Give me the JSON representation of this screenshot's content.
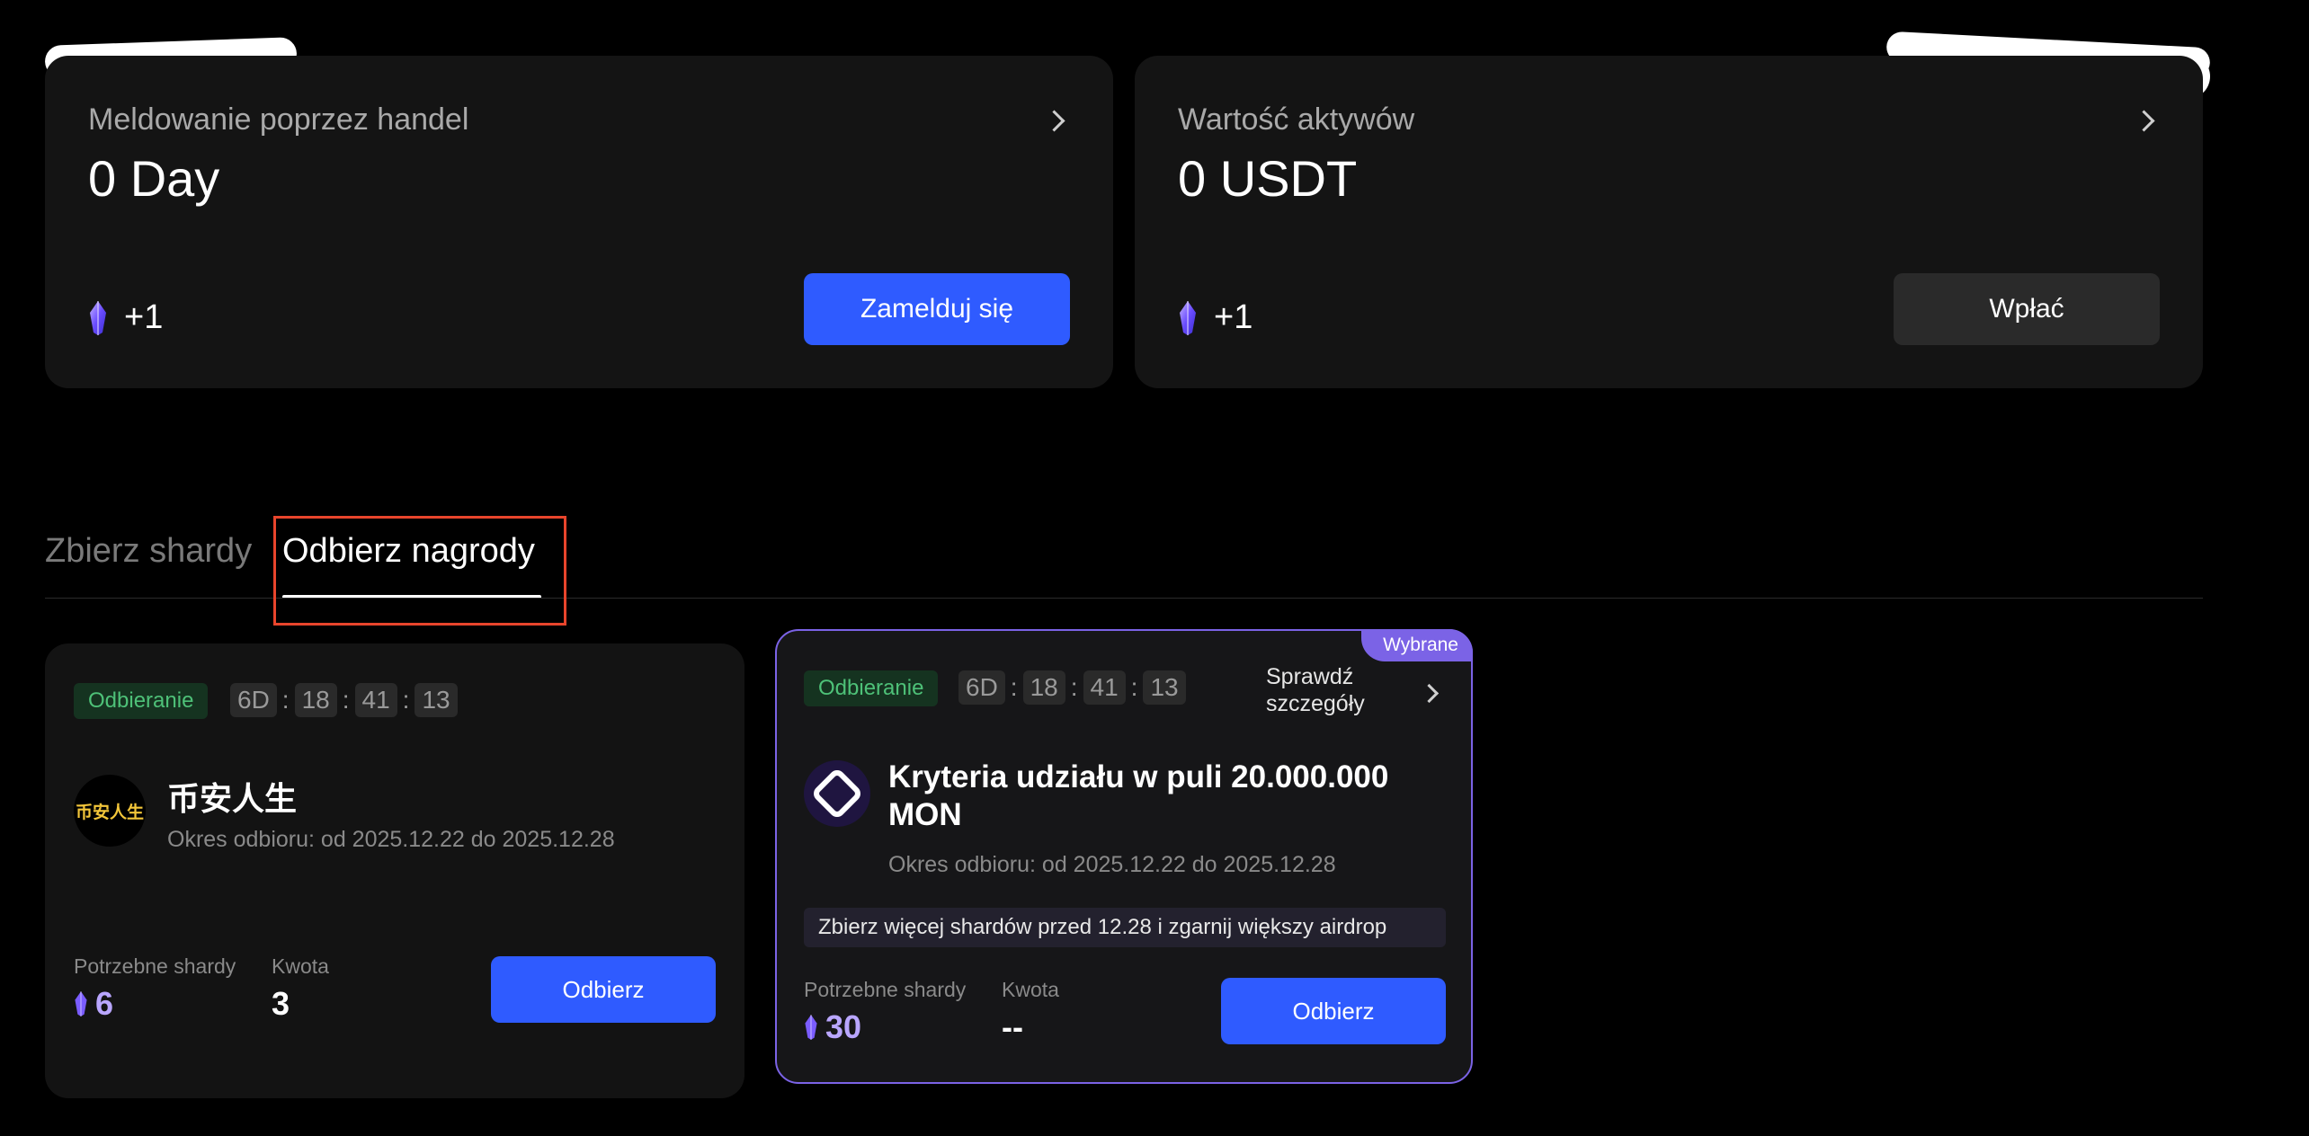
{
  "cards": [
    {
      "title": "Meldowanie poprzez handel",
      "value": "0 Day",
      "shard_bonus": "+1",
      "button": "Zamelduj się"
    },
    {
      "title": "Wartość aktywów",
      "value": "0 USDT",
      "shard_bonus": "+1",
      "button": "Wpłać"
    }
  ],
  "tabs": {
    "collect": "Zbierz shardy",
    "claim": "Odbierz nagrody",
    "active": "claim"
  },
  "rewards": [
    {
      "status": "Odbieranie",
      "timer": [
        "6D",
        "18",
        "41",
        "13"
      ],
      "logo_text": "币安人生",
      "title": "币安人生",
      "period": "Okres odbioru: od 2025.12.22 do 2025.12.28",
      "shards_label": "Potrzebne shardy",
      "shards_value": "6",
      "amount_label": "Kwota",
      "amount_value": "3",
      "button": "Odbierz"
    },
    {
      "badge": "Wybrane",
      "status": "Odbieranie",
      "timer": [
        "6D",
        "18",
        "41",
        "13"
      ],
      "details_link": "Sprawdź szczegóły",
      "title": "Kryteria udziału w puli 20.000.000 MON",
      "period": "Okres odbioru: od 2025.12.22 do 2025.12.28",
      "notice": "Zbierz więcej shardów przed 12.28 i zgarnij większy airdrop",
      "shards_label": "Potrzebne shardy",
      "shards_value": "30",
      "amount_label": "Kwota",
      "amount_value": "--",
      "button": "Odbierz"
    }
  ],
  "colors": {
    "accent_blue": "#2f5bff",
    "status_green": "#4ec178",
    "highlight_purple": "#7b63e6",
    "annotation_red": "#e8452c"
  }
}
